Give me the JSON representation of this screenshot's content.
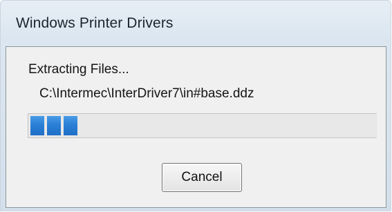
{
  "window": {
    "title": "Windows Printer Drivers"
  },
  "dialog": {
    "status_text": "Extracting Files...",
    "current_file": "C:\\Intermec\\InterDriver7\\in#base.ddz",
    "progress": {
      "filled_segments": 3,
      "color": "#2a7fd6"
    },
    "cancel_label": "Cancel"
  }
}
